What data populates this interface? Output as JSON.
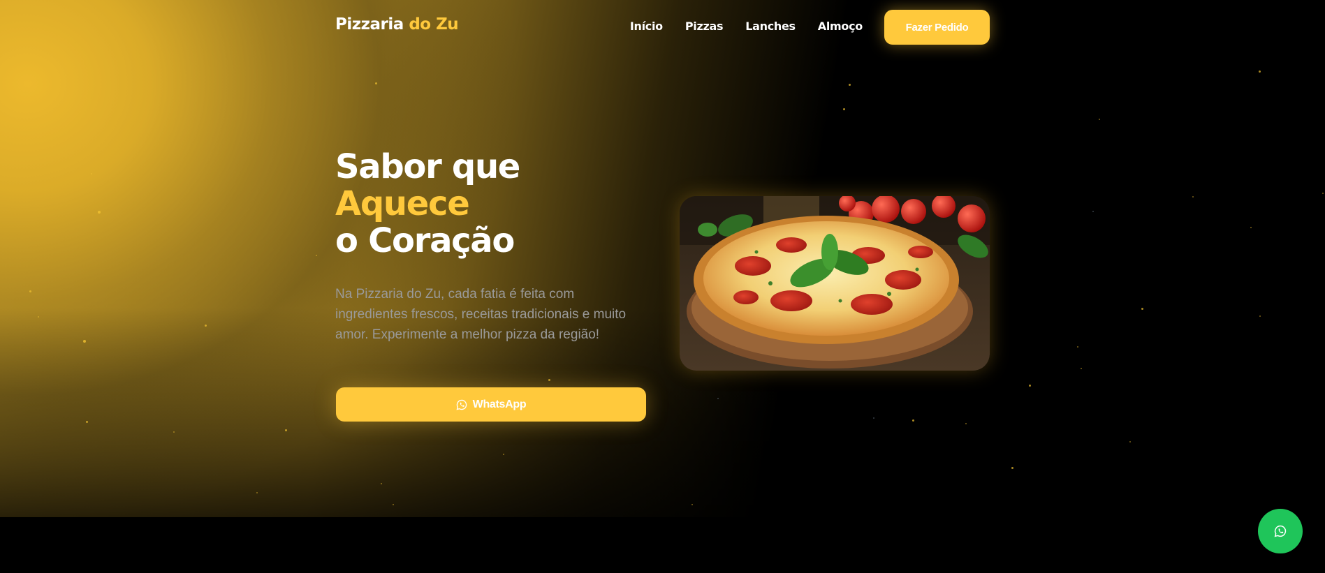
{
  "brand": {
    "name_main": "Pizzaria",
    "name_accent": "do Zu",
    "accent_color": "#ffc93c"
  },
  "nav": {
    "links": [
      {
        "label": "Início"
      },
      {
        "label": "Pizzas"
      },
      {
        "label": "Lanches"
      },
      {
        "label": "Almoço"
      }
    ],
    "cta_label": "Fazer Pedido"
  },
  "hero": {
    "headline_line1": "Sabor que",
    "headline_line2": "Aquece",
    "headline_line3": "o Coração",
    "description": "Na Pizzaria do Zu, cada fatia é feita com ingredientes frescos, receitas tradicionais e muito amor. Experimente a melhor pizza da região!",
    "whatsapp_label": "WhatsApp",
    "image_icon": "pizza-photo"
  },
  "floating": {
    "icon": "whatsapp-icon",
    "color": "#1fc55a"
  }
}
